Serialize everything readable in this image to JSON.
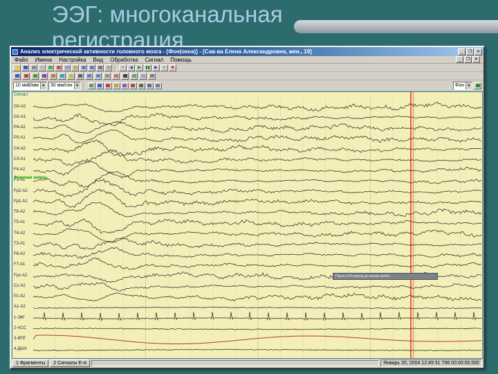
{
  "slide": {
    "title_line1": "ЭЭГ: многоканальная",
    "title_line2": "регистрация"
  },
  "colors": {
    "slide_bg": "#2d6c6c",
    "title_text": "#a9cbe2",
    "chart_bg": "#f4efb8",
    "grid": "#cfc98e",
    "trace": "#1e1e1e",
    "resp_trace": "#b03838",
    "cursor": "#d00000",
    "annotation_green": "#00a000"
  },
  "window": {
    "title": "Анализ электрической активности головного мозга - [Фон(окна)] - [Сав-ва Елена Александровна, жен., 19]",
    "window_buttons": [
      {
        "name": "minimize-button",
        "glyph": "_"
      },
      {
        "name": "maximize-button",
        "glyph": "❐"
      },
      {
        "name": "close-button",
        "glyph": "✕"
      }
    ],
    "mdi_buttons": [
      {
        "name": "mdi-minimize-button",
        "glyph": "_"
      },
      {
        "name": "mdi-restore-button",
        "glyph": "❐"
      },
      {
        "name": "mdi-close-button",
        "glyph": "✕"
      }
    ],
    "menu_items": [
      "Файл",
      "Имена",
      "Настройка",
      "Вид",
      "Обработка",
      "Сигнал",
      "Помощь"
    ],
    "toolbar1": [
      {
        "name": "open-file-icon",
        "color": "#e8c84a"
      },
      {
        "name": "save-file-icon",
        "color": "#3858b8"
      },
      {
        "name": "print-icon",
        "color": "#888888"
      },
      {
        "name": "preview-icon",
        "color": "#b8b8b8"
      },
      {
        "name": "export-icon",
        "color": "#58a858"
      },
      {
        "name": "cut-icon",
        "color": "#c05858"
      },
      {
        "name": "copy-icon",
        "color": "#9898c8"
      },
      {
        "name": "paste-icon",
        "color": "#c8a858"
      },
      {
        "name": "undo-icon",
        "color": "#6878c8"
      },
      {
        "name": "redo-icon",
        "color": "#6878c8"
      },
      {
        "name": "find-icon",
        "color": "#787878"
      },
      {
        "name": "properties-icon",
        "color": "#a8a8a8"
      }
    ],
    "toolbar1_nav": [
      {
        "name": "goto-start-button",
        "glyph": "«",
        "color": "#2040c0"
      },
      {
        "name": "page-back-button",
        "glyph": "◀",
        "color": "#2040c0"
      },
      {
        "name": "play-button",
        "glyph": "▶",
        "color": "#0a8a0a"
      },
      {
        "name": "pause-button",
        "glyph": "▮▮",
        "color": "#0a8a0a"
      },
      {
        "name": "page-forward-button",
        "glyph": "▶",
        "color": "#2040c0"
      },
      {
        "name": "goto-end-button",
        "glyph": "»",
        "color": "#2040c0"
      },
      {
        "name": "stop-button",
        "glyph": "■",
        "color": "#b02020"
      }
    ],
    "toolbar2": [
      {
        "name": "montage-icon",
        "color": "#4060c0"
      },
      {
        "name": "filter-icon",
        "color": "#c04040"
      },
      {
        "name": "gain-icon",
        "color": "#40a040"
      },
      {
        "name": "spectrum-icon",
        "color": "#8040c0"
      },
      {
        "name": "brain-map-icon",
        "color": "#c08040"
      },
      {
        "name": "split-view-icon",
        "color": "#40a0c0"
      },
      {
        "name": "marker-icon",
        "color": "#c0c040"
      },
      {
        "name": "ruler-icon",
        "color": "#606060"
      },
      {
        "name": "zoom-in-icon",
        "color": "#6080e0"
      },
      {
        "name": "zoom-out-icon",
        "color": "#6080e0"
      },
      {
        "name": "select-icon",
        "color": "#909090"
      },
      {
        "name": "erase-icon",
        "color": "#c07070"
      },
      {
        "name": "text-note-icon",
        "color": "#404040"
      },
      {
        "name": "grid-icon",
        "color": "#70a070"
      },
      {
        "name": "snapshot-icon",
        "color": "#a0a0c0"
      },
      {
        "name": "settings-icon",
        "color": "#808080"
      }
    ],
    "toolbar3": {
      "gain_value": "10 мкВ/мм",
      "speed_value": "30 мм/сек",
      "icons": [
        {
          "name": "grid-toggle-icon",
          "color": "#60a060"
        },
        {
          "name": "cursor-mode-icon",
          "color": "#4060c0"
        },
        {
          "name": "marks-icon",
          "color": "#c04040"
        },
        {
          "name": "events-icon",
          "color": "#c0a040"
        },
        {
          "name": "epoch-icon",
          "color": "#8060c0"
        },
        {
          "name": "artifact-icon",
          "color": "#a05050"
        },
        {
          "name": "baseline-icon",
          "color": "#507050"
        },
        {
          "name": "smooth-icon",
          "color": "#5070a0"
        },
        {
          "name": "lock-icon",
          "color": "#808080"
        }
      ]
    },
    "mode_combo": {
      "value": "Фон"
    },
    "chart": {
      "corner_label": "Сигнал",
      "annotation": "Фоновая запись",
      "tooltip": "Пауза 120 секунд до конца пробы",
      "channels": [
        {
          "label": "O2-A2",
          "type": "eeg"
        },
        {
          "label": "O1-A1",
          "type": "eeg"
        },
        {
          "label": "P4-A2",
          "type": "eeg"
        },
        {
          "label": "P3-A1",
          "type": "eeg"
        },
        {
          "label": "C4-A2",
          "type": "eeg"
        },
        {
          "label": "C3-A1",
          "type": "eeg"
        },
        {
          "label": "F4-A2",
          "type": "eeg"
        },
        {
          "label": "F3-A1",
          "type": "eeg"
        },
        {
          "label": "Fp2-A2",
          "type": "eeg"
        },
        {
          "label": "Fp1-A1",
          "type": "eeg"
        },
        {
          "label": "T6-A2",
          "type": "eeg"
        },
        {
          "label": "T5-A1",
          "type": "eeg"
        },
        {
          "label": "T4-A2",
          "type": "eeg"
        },
        {
          "label": "T3-A1",
          "type": "eeg"
        },
        {
          "label": "F8-A2",
          "type": "eeg"
        },
        {
          "label": "F7-A1",
          "type": "eeg"
        },
        {
          "label": "Fpz-A2",
          "type": "eeg"
        },
        {
          "label": "Cz-A2",
          "type": "eeg"
        },
        {
          "label": "Pz-A2",
          "type": "eeg"
        },
        {
          "label": "A1-A2",
          "type": "flat"
        },
        {
          "label": "1-ЭКГ",
          "type": "ecg"
        },
        {
          "label": "2-ЧСС",
          "type": "flat"
        },
        {
          "label": "3-ФПГ",
          "type": "resp"
        },
        {
          "label": "4-ДЫХ",
          "type": "flat"
        }
      ]
    },
    "statusbar": {
      "tabs": [
        "1 Фрагменты",
        "2 Сигналы Е-А"
      ],
      "timestamp": "Январь 20, 2004  12:49:31 798  00:00:00.000"
    }
  }
}
